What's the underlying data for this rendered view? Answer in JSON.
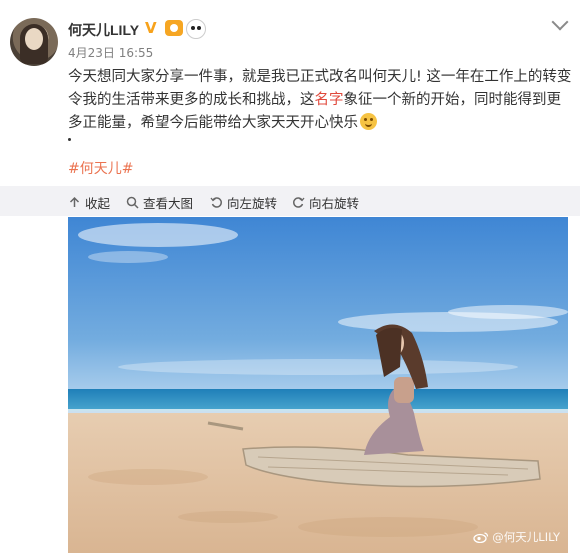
{
  "post": {
    "username": "何天儿LILY",
    "verified_mark": "V",
    "timestamp": "4月23日 16:55",
    "text_part1": "今天想同大家分享一件事，就是我已正式改名叫何天儿! 这一年在工作上的转变令我的生活带来更多的成长和挑战，这",
    "text_highlight": "名字",
    "text_part2": "象征一个新的开始，同时能得到更多正能量，希望今后能带给大家天天开心快乐",
    "dot_line": "·",
    "hashtag": "#何天儿#"
  },
  "toolbar": {
    "collapse_label": "收起",
    "view_large_label": "查看大图",
    "rotate_left_label": "向左旋转",
    "rotate_right_label": "向右旋转"
  },
  "photo": {
    "watermark": "@何天儿LILY"
  },
  "colors": {
    "hashtag": "#eb7350",
    "highlight": "#e0493c",
    "verified": "#f7a21b",
    "toolbar_bg": "#f2f2f5"
  },
  "icons": [
    "chevron-down-icon",
    "verified-icon",
    "vip-badge-icon",
    "panda-icon",
    "emoji-icon",
    "collapse-icon",
    "zoom-icon",
    "rotate-left-icon",
    "rotate-right-icon",
    "weibo-icon"
  ]
}
